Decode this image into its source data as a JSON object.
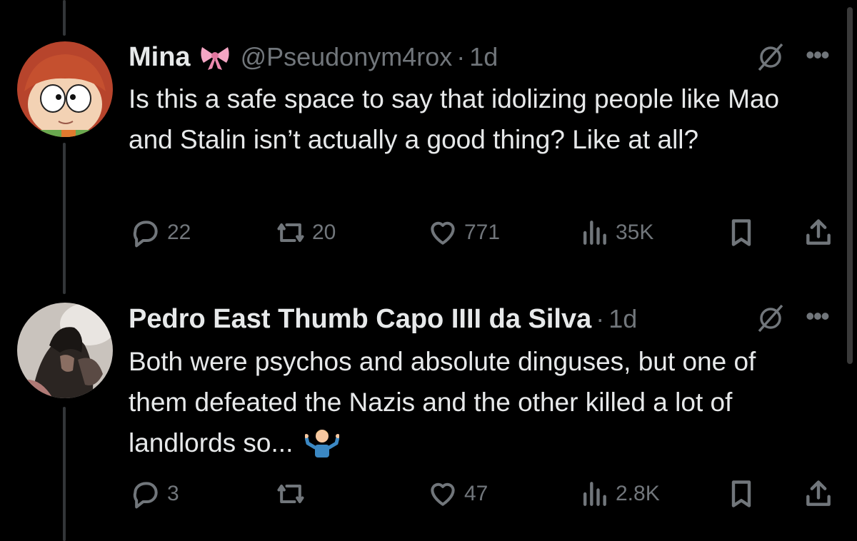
{
  "colors": {
    "background": "#000000",
    "text": "#e7e9ea",
    "muted": "#71767b",
    "thread_line": "#333639"
  },
  "tweets": [
    {
      "name": "Mina",
      "emoji_icon": "ribbon-bow-icon",
      "handle": "@Pseudonym4rox",
      "dot": "·",
      "time": "1d",
      "text": "Is this a safe space to say that idolizing people like Mao and Stalin isn’t actually a good thing? Like at all?",
      "replies": "22",
      "reposts": "20",
      "likes": "771",
      "views": "35K"
    },
    {
      "name": "Pedro East Thumb Capo IIII da Silva",
      "handle": "",
      "dot": "·",
      "time": "1d",
      "text": "Both were psychos and absolute dinguses, but one of them defeated the Nazis and the other killed a lot of landlords so...",
      "text_emoji_icon": "person-shrugging-icon",
      "replies": "3",
      "reposts": "",
      "likes": "47",
      "views": "2.8K"
    }
  ]
}
